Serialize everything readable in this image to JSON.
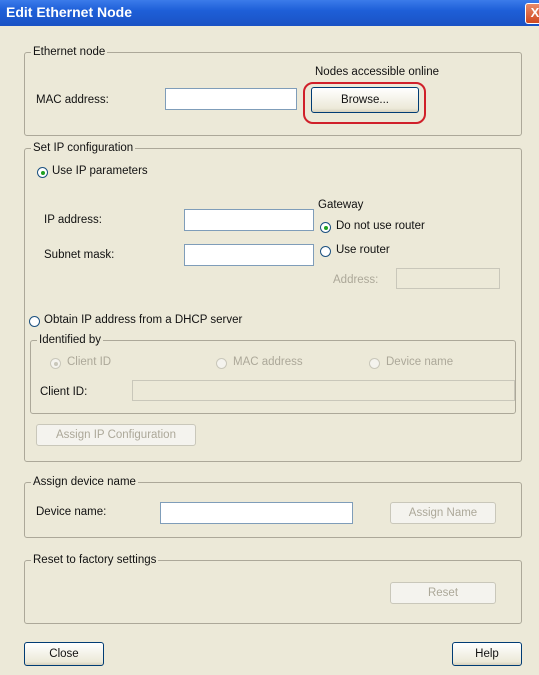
{
  "window": {
    "title": "Edit Ethernet Node",
    "close_glyph": "X"
  },
  "ethernet_node": {
    "legend": "Ethernet node",
    "nodes_label": "Nodes accessible online",
    "mac_label": "MAC address:",
    "mac_value": "",
    "browse_label": "Browse..."
  },
  "ip_config": {
    "legend": "Set IP configuration",
    "use_ip_params": "Use IP parameters",
    "ip_label": "IP address:",
    "ip_value": "",
    "subnet_label": "Subnet mask:",
    "subnet_value": "",
    "gateway_label": "Gateway",
    "no_router": "Do not use router",
    "use_router": "Use router",
    "router_address_label": "Address:",
    "router_address_value": "",
    "dhcp_label": "Obtain IP address from a DHCP server",
    "identified_by": {
      "legend": "Identified by",
      "client_id": "Client ID",
      "mac_address": "MAC address",
      "device_name": "Device name",
      "client_id_label": "Client ID:",
      "client_id_value": ""
    },
    "assign_ip_label": "Assign IP Configuration"
  },
  "device_name": {
    "legend": "Assign device name",
    "label": "Device name:",
    "value": "",
    "assign_label": "Assign Name"
  },
  "factory": {
    "legend": "Reset to factory settings",
    "reset_label": "Reset"
  },
  "footer": {
    "close_label": "Close",
    "help_label": "Help"
  },
  "colors": {
    "titlebar": "#1e5fd8",
    "dialog_bg": "#ece9d8",
    "highlight": "#d0202a"
  }
}
